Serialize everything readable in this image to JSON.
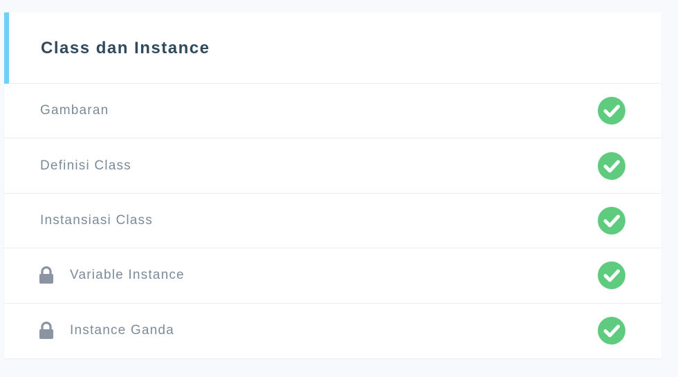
{
  "module": {
    "title": "Class dan Instance",
    "accent_color": "#6dd0f6",
    "lessons": [
      {
        "label": "Gambaran",
        "locked": false,
        "status": "completed",
        "status_icon": "check-circle-icon"
      },
      {
        "label": "Definisi Class",
        "locked": false,
        "status": "completed",
        "status_icon": "check-circle-icon"
      },
      {
        "label": "Instansiasi Class",
        "locked": false,
        "status": "completed",
        "status_icon": "check-circle-icon"
      },
      {
        "label": "Variable Instance",
        "locked": true,
        "lock_icon": "lock-icon",
        "status": "completed",
        "status_icon": "check-circle-icon"
      },
      {
        "label": "Instance Ganda",
        "locked": true,
        "lock_icon": "lock-icon",
        "status": "completed",
        "status_icon": "check-circle-icon"
      }
    ],
    "colors": {
      "completed": "#5ecb7f",
      "lock": "#8a94a3",
      "label": "#7d8b99",
      "title": "#2e4a5c"
    }
  }
}
